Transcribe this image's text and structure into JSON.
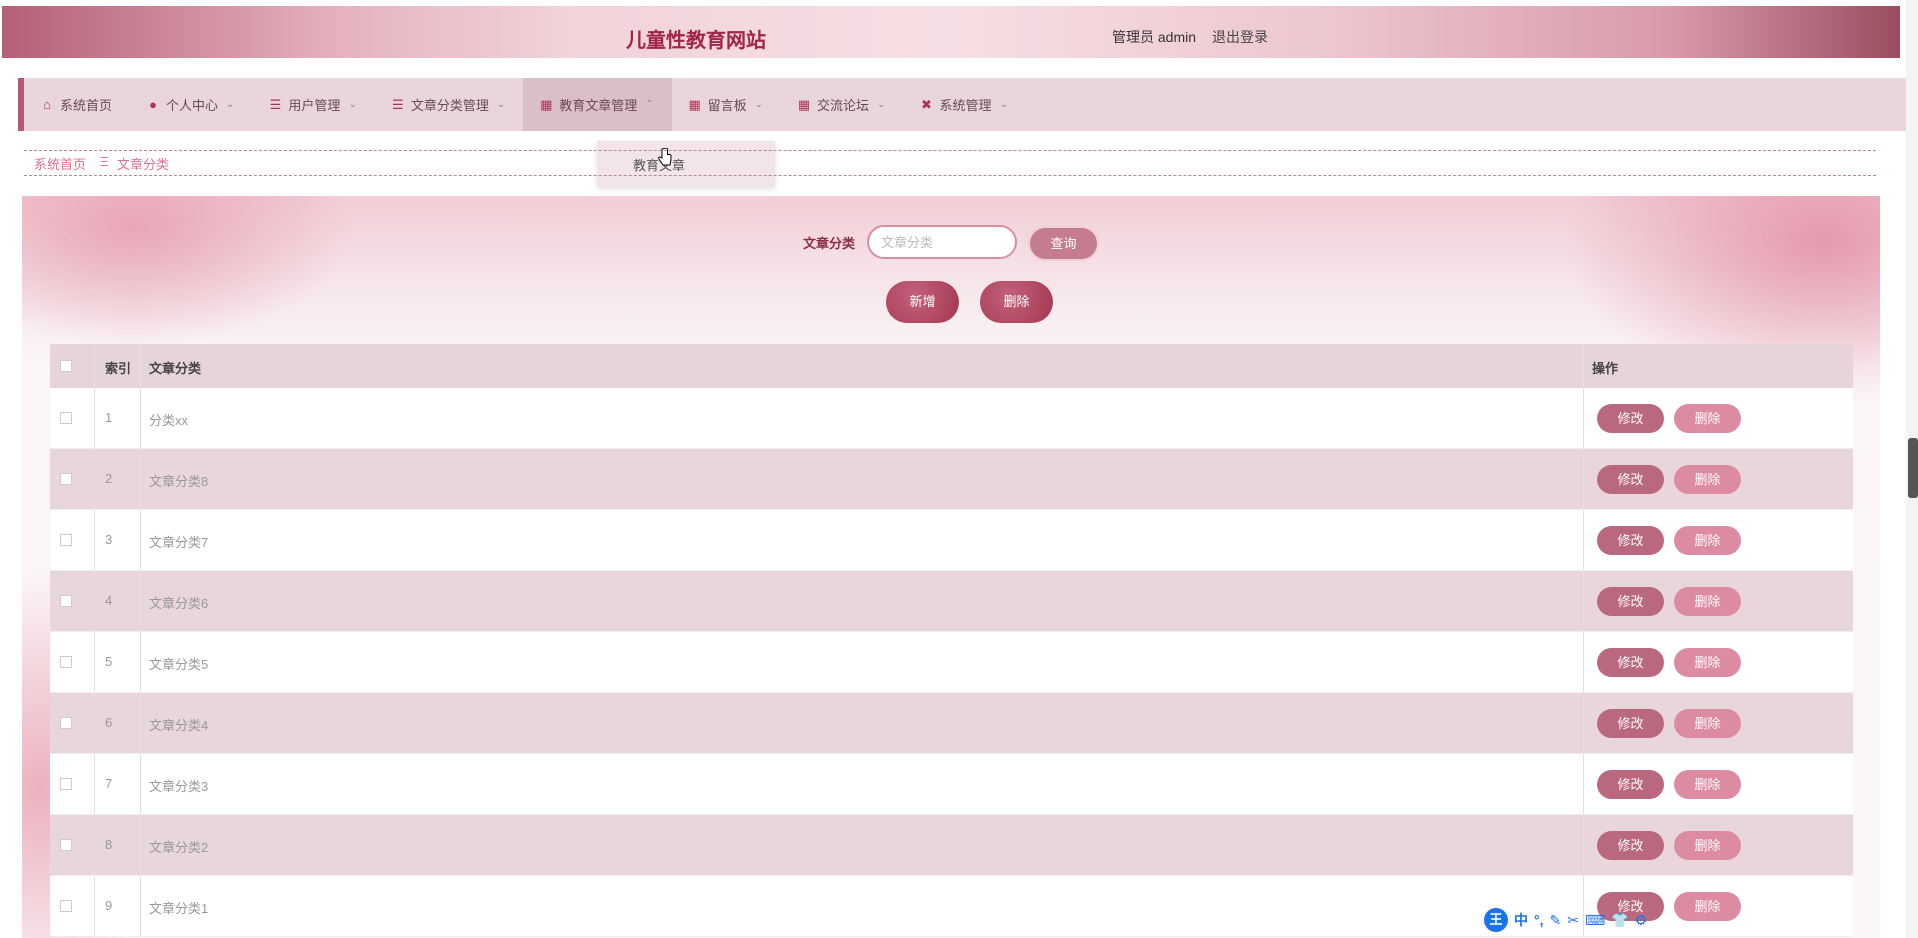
{
  "header": {
    "title": "儿童性教育网站",
    "user": "管理员 admin",
    "logout": "退出登录"
  },
  "nav": [
    {
      "label": "系统首页",
      "icon": "home-icon",
      "chev": ""
    },
    {
      "label": "个人中心",
      "icon": "person-icon",
      "chev": "⌄"
    },
    {
      "label": "用户管理",
      "icon": "list-icon",
      "chev": "⌄"
    },
    {
      "label": "文章分类管理",
      "icon": "list-icon",
      "chev": "⌄"
    },
    {
      "label": "教育文章管理",
      "icon": "grid-icon",
      "chev": "⌃"
    },
    {
      "label": "留言板",
      "icon": "grid-icon",
      "chev": "⌄"
    },
    {
      "label": "交流论坛",
      "icon": "grid-icon",
      "chev": "⌄"
    },
    {
      "label": "系统管理",
      "icon": "ticket-icon",
      "chev": "⌄"
    }
  ],
  "dropdown": {
    "item": "教育文章"
  },
  "breadcrumb": {
    "home": "系统首页",
    "sep": "Ξ",
    "current": "文章分类"
  },
  "search": {
    "label": "文章分类",
    "placeholder": "文章分类",
    "button": "查询"
  },
  "actions": {
    "add": "新增",
    "delete": "删除"
  },
  "table": {
    "headers": {
      "index": "索引",
      "name": "文章分类",
      "ops": "操作"
    },
    "edit_label": "修改",
    "delete_label": "删除",
    "rows": [
      {
        "index": "1",
        "name": "分类xx"
      },
      {
        "index": "2",
        "name": "文章分类8"
      },
      {
        "index": "3",
        "name": "文章分类7"
      },
      {
        "index": "4",
        "name": "文章分类6"
      },
      {
        "index": "5",
        "name": "文章分类5"
      },
      {
        "index": "6",
        "name": "文章分类4"
      },
      {
        "index": "7",
        "name": "文章分类3"
      },
      {
        "index": "8",
        "name": "文章分类2"
      },
      {
        "index": "9",
        "name": "文章分类1"
      }
    ]
  },
  "ime": {
    "logo": "王",
    "keys": [
      "中",
      "°,",
      "✎",
      "✂",
      "⌨",
      "👕",
      "⚙"
    ]
  },
  "colors": {
    "accent": "#a3244a",
    "nav_bg": "#e9d6da",
    "btn": "#b9687f",
    "btn_light": "#dd8ba3"
  }
}
